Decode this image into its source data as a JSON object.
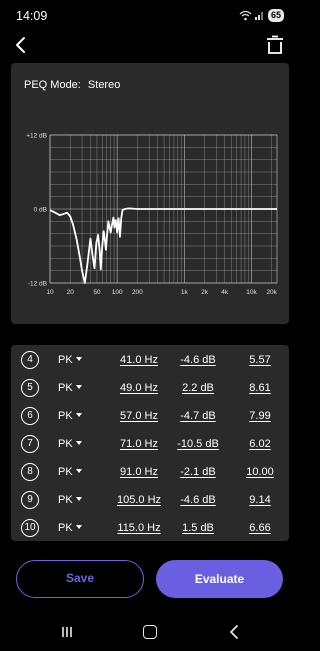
{
  "status": {
    "time": "14:09",
    "battery": "65"
  },
  "header": {
    "back_icon": "chevron-left-icon",
    "delete_icon": "trash-icon"
  },
  "graph": {
    "mode_label": "PEQ Mode:",
    "mode_value": "Stereo",
    "y_ticks": [
      "+12 dB",
      "0 dB",
      "-12 dB"
    ],
    "x_ticks": [
      "10",
      "20",
      "50",
      "100",
      "200",
      "1k",
      "2k",
      "4k",
      "10k",
      "20k"
    ]
  },
  "chart_data": {
    "type": "line",
    "x_scale": "log",
    "xlim": [
      10,
      24000
    ],
    "ylim": [
      -12,
      12
    ],
    "grid": true,
    "x": [
      10,
      12,
      14,
      16,
      18,
      20,
      22,
      25,
      28,
      30,
      33,
      36,
      40,
      43,
      46,
      49,
      52,
      55,
      57,
      60,
      63,
      66,
      68,
      71,
      74,
      77,
      80,
      84,
      88,
      91,
      95,
      100,
      105,
      110,
      115,
      120,
      130,
      150,
      200,
      300,
      1000,
      10000,
      24000
    ],
    "y": [
      -0.2,
      -0.6,
      -1.0,
      -0.8,
      -0.6,
      -1.2,
      -2.5,
      -5.0,
      -8.0,
      -10.0,
      -12.0,
      -9.0,
      -4.8,
      -7.5,
      -9.6,
      -5.5,
      -4.2,
      -6.8,
      -9.8,
      -6.0,
      -3.6,
      -5.2,
      -6.6,
      -4.0,
      -2.0,
      -3.0,
      -3.8,
      -2.5,
      -1.4,
      -3.0,
      -1.8,
      -3.8,
      -1.5,
      -4.5,
      -1.5,
      -0.2,
      0.0,
      0.1,
      0.0,
      0.0,
      0.0,
      0.0,
      0.0
    ]
  },
  "bands": [
    {
      "num": "4",
      "type": "PK",
      "freq": "41.0 Hz",
      "gain": "-4.6 dB",
      "q": "5.57"
    },
    {
      "num": "5",
      "type": "PK",
      "freq": "49.0 Hz",
      "gain": "2.2 dB",
      "q": "8.61"
    },
    {
      "num": "6",
      "type": "PK",
      "freq": "57.0 Hz",
      "gain": "-4.7 dB",
      "q": "7.99"
    },
    {
      "num": "7",
      "type": "PK",
      "freq": "71.0 Hz",
      "gain": "-10.5 dB",
      "q": "6.02"
    },
    {
      "num": "8",
      "type": "PK",
      "freq": "91.0 Hz",
      "gain": "-2.1 dB",
      "q": "10.00"
    },
    {
      "num": "9",
      "type": "PK",
      "freq": "105.0 Hz",
      "gain": "-4.6 dB",
      "q": "9.14"
    },
    {
      "num": "10",
      "type": "PK",
      "freq": "115.0 Hz",
      "gain": "1.5 dB",
      "q": "6.66"
    }
  ],
  "actions": {
    "save_label": "Save",
    "evaluate_label": "Evaluate"
  },
  "colors": {
    "accent": "#6a5fe0",
    "card": "#2a2a2a",
    "background": "#000000"
  }
}
